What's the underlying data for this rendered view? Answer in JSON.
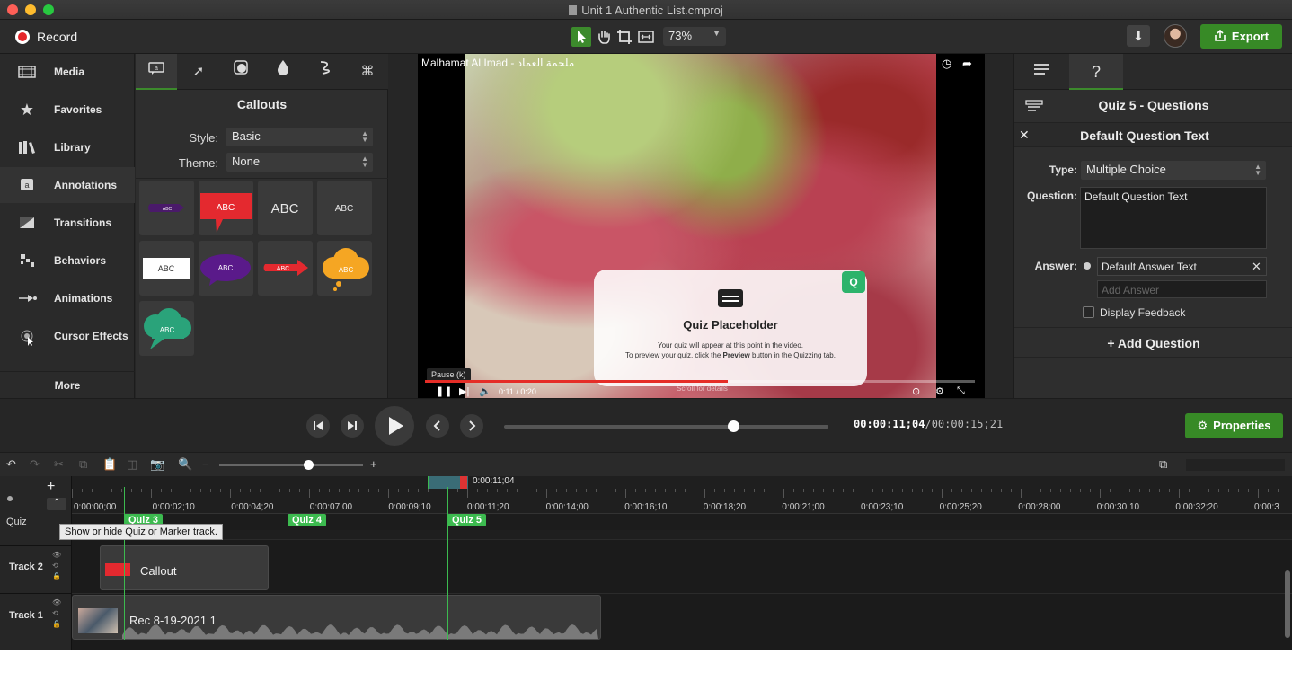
{
  "window": {
    "title": "Unit 1 Authentic List.cmproj"
  },
  "toolbar": {
    "record_label": "Record",
    "zoom": "73%",
    "export_label": "Export"
  },
  "sidebar": {
    "items": [
      {
        "label": "Media",
        "icon": "film-icon"
      },
      {
        "label": "Favorites",
        "icon": "star-icon"
      },
      {
        "label": "Library",
        "icon": "library-icon"
      },
      {
        "label": "Annotations",
        "icon": "annotations-icon"
      },
      {
        "label": "Transitions",
        "icon": "transitions-icon"
      },
      {
        "label": "Behaviors",
        "icon": "behaviors-icon"
      },
      {
        "label": "Animations",
        "icon": "animations-icon"
      },
      {
        "label": "Cursor Effects",
        "icon": "cursor-icon"
      }
    ],
    "more_label": "More"
  },
  "callouts": {
    "title": "Callouts",
    "style_label": "Style:",
    "style_value": "Basic",
    "theme_label": "Theme:",
    "theme_value": "None",
    "tile_text": "ABC"
  },
  "preview": {
    "video_title": "Malhamat Al Imad - ملحمة العماد",
    "quiz_title": "Quiz Placeholder",
    "quiz_line1": "Your quiz will appear at this point in the video.",
    "quiz_line2_pre": "To preview your quiz, click the ",
    "quiz_line2_bold": "Preview",
    "quiz_line2_post": " button in the Quizzing tab.",
    "quiz_badge": "Q",
    "pause_tooltip": "Pause (k)",
    "time": "0:11 / 0:20",
    "scrub_label": "Scroll for details",
    "progress_fraction": 0.55
  },
  "properties": {
    "title": "Quiz 5 - Questions",
    "question_header": "Default Question Text",
    "type_label": "Type:",
    "type_value": "Multiple Choice",
    "question_label": "Question:",
    "question_value": "Default Question Text",
    "answer_label": "Answer:",
    "answer_value": "Default Answer Text",
    "add_answer_placeholder": "Add Answer",
    "display_feedback": "Display Feedback",
    "add_question": "+ Add Question",
    "button_label": "Properties"
  },
  "playback": {
    "time_current": "00:00:11;04",
    "time_total": "/00:00:15;21",
    "position_fraction": 0.705
  },
  "timeline": {
    "playhead_time": "0:00:11;04",
    "ticks": [
      "0:00:00;00",
      "0:00:02;10",
      "0:00:04;20",
      "0:00:07;00",
      "0:00:09;10",
      "0:00:11;20",
      "0:00:14;00",
      "0:00:16;10",
      "0:00:18;20",
      "0:00:21;00",
      "0:00:23;10",
      "0:00:25;20",
      "0:00:28;00",
      "0:00:30;10",
      "0:00:32;20",
      "0:00:3"
    ],
    "quiz_track_label": "Quiz",
    "quiz_markers": [
      "Quiz 3",
      "Quiz 4",
      "Quiz 5"
    ],
    "tooltip": "Show or hide Quiz or Marker track.",
    "tracks": [
      {
        "name": "Track 2",
        "clip": "Callout"
      },
      {
        "name": "Track 1",
        "clip": "Rec 8-19-2021 1"
      }
    ]
  }
}
